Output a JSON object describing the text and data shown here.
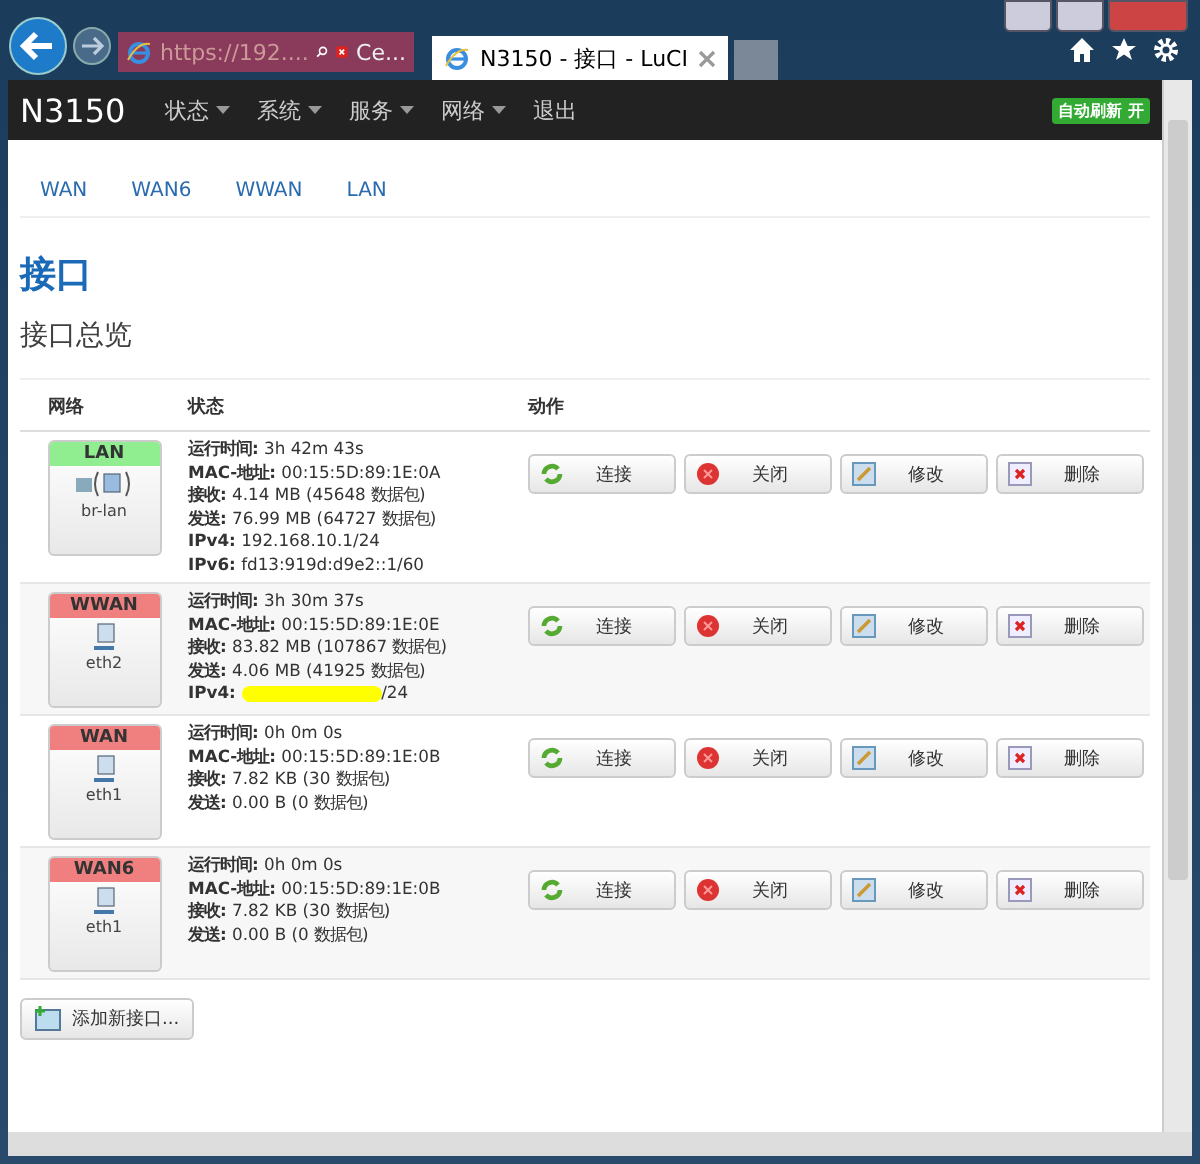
{
  "browser": {
    "address": "https://192....",
    "cert_error": "Ce...",
    "tab_title": "N3150 - 接口 - LuCI"
  },
  "navbar": {
    "brand": "N3150",
    "menus": [
      {
        "label": "状态",
        "dropdown": true
      },
      {
        "label": "系统",
        "dropdown": true
      },
      {
        "label": "服务",
        "dropdown": true
      },
      {
        "label": "网络",
        "dropdown": true
      },
      {
        "label": "退出",
        "dropdown": false
      }
    ],
    "auto_refresh": "自动刷新 开"
  },
  "subtabs": [
    {
      "label": "WAN"
    },
    {
      "label": "WAN6"
    },
    {
      "label": "WWAN"
    },
    {
      "label": "LAN"
    }
  ],
  "page_title": "接口",
  "section_title": "接口总览",
  "table": {
    "columns": [
      "网络",
      "状态",
      "动作"
    ],
    "rows": [
      {
        "name": "LAN",
        "color": "#90ee90",
        "bridge": true,
        "device": "br-lan",
        "lines": [
          {
            "label": "运行时间:",
            "value": "3h 42m 43s"
          },
          {
            "label": "MAC-地址:",
            "value": "00:15:5D:89:1E:0A"
          },
          {
            "label": "接收:",
            "value": "4.14 MB (45648 数据包)"
          },
          {
            "label": "发送:",
            "value": "76.99 MB (64727 数据包)"
          },
          {
            "label": "IPv4:",
            "value": "192.168.10.1/24"
          },
          {
            "label": "IPv6:",
            "value": "fd13:919d:d9e2::1/60"
          }
        ],
        "actions": [
          {
            "kind": "connect",
            "label": "连接"
          },
          {
            "kind": "stop",
            "label": "关闭"
          },
          {
            "kind": "edit",
            "label": "修改"
          },
          {
            "kind": "delete",
            "label": "删除"
          }
        ]
      },
      {
        "name": "WWAN",
        "color": "#f08080",
        "bridge": false,
        "device": "eth2",
        "lines": [
          {
            "label": "运行时间:",
            "value": "3h 30m 37s"
          },
          {
            "label": "MAC-地址:",
            "value": "00:15:5D:89:1E:0E"
          },
          {
            "label": "接收:",
            "value": "83.82 MB (107867 数据包)"
          },
          {
            "label": "发送:",
            "value": "4.06 MB (41925 数据包)"
          },
          {
            "label": "IPv4:",
            "value": "/24",
            "redacted": true
          }
        ],
        "actions": [
          {
            "kind": "connect",
            "label": "连接"
          },
          {
            "kind": "stop",
            "label": "关闭"
          },
          {
            "kind": "edit",
            "label": "修改"
          },
          {
            "kind": "delete",
            "label": "删除"
          }
        ]
      },
      {
        "name": "WAN",
        "color": "#f08080",
        "bridge": false,
        "device": "eth1",
        "lines": [
          {
            "label": "运行时间:",
            "value": "0h 0m 0s"
          },
          {
            "label": "MAC-地址:",
            "value": "00:15:5D:89:1E:0B"
          },
          {
            "label": "接收:",
            "value": "7.82 KB (30 数据包)"
          },
          {
            "label": "发送:",
            "value": "0.00 B (0 数据包)"
          }
        ],
        "actions": [
          {
            "kind": "connect",
            "label": "连接"
          },
          {
            "kind": "stop",
            "label": "关闭"
          },
          {
            "kind": "edit",
            "label": "修改"
          },
          {
            "kind": "delete",
            "label": "删除"
          }
        ]
      },
      {
        "name": "WAN6",
        "color": "#f08080",
        "bridge": false,
        "device": "eth1",
        "lines": [
          {
            "label": "运行时间:",
            "value": "0h 0m 0s"
          },
          {
            "label": "MAC-地址:",
            "value": "00:15:5D:89:1E:0B"
          },
          {
            "label": "接收:",
            "value": "7.82 KB (30 数据包)"
          },
          {
            "label": "发送:",
            "value": "0.00 B (0 数据包)"
          }
        ],
        "actions": [
          {
            "kind": "connect",
            "label": "连接"
          },
          {
            "kind": "stop",
            "label": "关闭"
          },
          {
            "kind": "edit",
            "label": "修改"
          },
          {
            "kind": "delete",
            "label": "删除"
          }
        ]
      }
    ]
  },
  "add_button": "添加新接口..."
}
